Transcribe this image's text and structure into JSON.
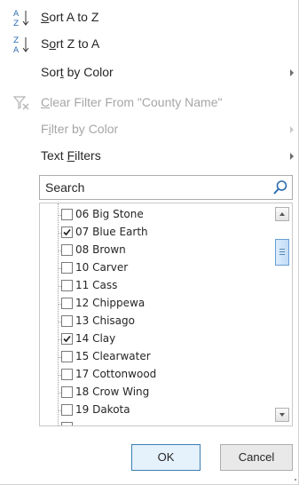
{
  "menu": {
    "sort_az": {
      "pre": "",
      "ul": "S",
      "post": "ort A to Z",
      "icon_top": "A",
      "icon_bottom": "Z"
    },
    "sort_za": {
      "pre": "S",
      "ul": "o",
      "post": "rt Z to A",
      "icon_top": "Z",
      "icon_bottom": "A"
    },
    "sort_by_color": {
      "pre": "Sor",
      "ul": "t",
      "post": " by Color"
    },
    "clear_filter": {
      "pre": "",
      "ul": "C",
      "post": "lear Filter From \"County Name\""
    },
    "filter_by_color": {
      "pre": "F",
      "ul": "i",
      "post": "lter by Color"
    },
    "text_filters": {
      "pre": "Text ",
      "ul": "F",
      "post": "ilters"
    }
  },
  "search": {
    "placeholder": "Search",
    "value": ""
  },
  "list": {
    "items": [
      {
        "label": "06 Big Stone",
        "checked": false
      },
      {
        "label": "07 Blue Earth",
        "checked": true
      },
      {
        "label": "08 Brown",
        "checked": false
      },
      {
        "label": "10 Carver",
        "checked": false
      },
      {
        "label": "11 Cass",
        "checked": false
      },
      {
        "label": "12 Chippewa",
        "checked": false
      },
      {
        "label": "13 Chisago",
        "checked": false
      },
      {
        "label": "14 Clay",
        "checked": true
      },
      {
        "label": "15 Clearwater",
        "checked": false
      },
      {
        "label": "17 Cottonwood",
        "checked": false
      },
      {
        "label": "18 Crow Wing",
        "checked": false
      },
      {
        "label": "19 Dakota",
        "checked": false
      },
      {
        "label": "",
        "checked": false
      }
    ]
  },
  "buttons": {
    "ok": "OK",
    "cancel": "Cancel"
  },
  "colors": {
    "text": "#262626",
    "disabled_text": "#a6a6a6",
    "ok_border": "#3c7fb1",
    "scroll_thumb": "#c2dcf5",
    "sort_icon_blue": "#2b6cb0"
  },
  "icons": {
    "sort_az": "sort-ascending-icon",
    "sort_za": "sort-descending-icon",
    "clear_filter": "funnel-clear-icon",
    "search": "magnifier-icon",
    "submenu": "triangle-right-icon"
  }
}
